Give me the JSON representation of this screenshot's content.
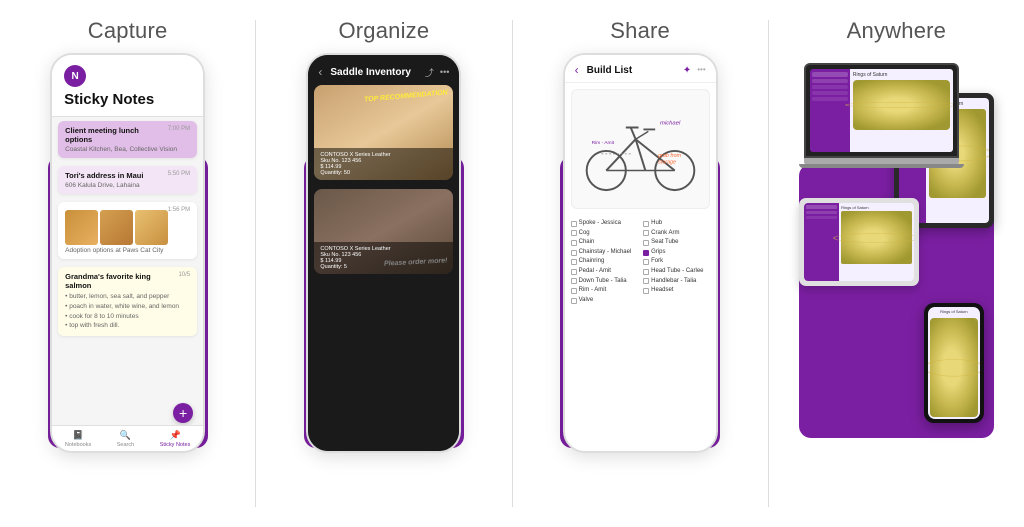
{
  "sections": [
    {
      "id": "capture",
      "title": "Capture",
      "app": {
        "header_icon": "N",
        "title": "Sticky Notes",
        "notes": [
          {
            "title": "Client meeting lunch options",
            "subtitle": "Coastal Kitchen, Bea, Collective Vision",
            "time": "7:00 PM",
            "type": "highlight"
          },
          {
            "title": "Tori's address in Maui",
            "subtitle": "606 Kalula Drive, Lahaina",
            "time": "5:50 PM",
            "type": "highlight2"
          },
          {
            "title": "Adoption options at Paws Cat City",
            "subtitle": "",
            "time": "1:56 PM",
            "type": "image"
          },
          {
            "title": "Grandma's favorite king salmon",
            "subtitle": "• butter, lemon, sea salt, and pepper\n• poach in water, white wine, and lemon\n• cook for 8 to 10 minutes\n• top with fresh dill.",
            "time": "10/5",
            "type": "yellow"
          }
        ],
        "nav_items": [
          {
            "label": "Notebooks",
            "icon": "📓",
            "active": false
          },
          {
            "label": "Search",
            "icon": "🔍",
            "active": false
          },
          {
            "label": "Sticky Notes",
            "icon": "📌",
            "active": true
          }
        ]
      }
    },
    {
      "id": "organize",
      "title": "Organize",
      "app": {
        "title": "Saddle Inventory",
        "items": [
          {
            "product": "CONTOSO X Series Leather",
            "sku": "Sku No. 123 456",
            "price": "$ 114.99",
            "quantity": "Quantity: 50",
            "annotation": "TOP RECOMMENDATION",
            "annotation_color": "#ffeb3b"
          },
          {
            "product": "CONTOSO X Series Leather",
            "sku": "Sku No. 123 456",
            "price": "$ 114.99",
            "quantity": "Quantity: 5",
            "annotation": "Please order more!",
            "annotation_color": "#ffffff"
          }
        ]
      }
    },
    {
      "id": "share",
      "title": "Share",
      "app": {
        "title": "Build List",
        "col1_items": [
          "Spoke - Jessica",
          "Cog",
          "Chain",
          "Chainstay - Michael",
          "Chainring",
          "Pedal - Amit",
          "Down Tube - Talia",
          "Rim - Amit",
          "Valve"
        ],
        "col2_items": [
          "Hub",
          "Crank Arm",
          "Seat Tube",
          "Grips",
          "Fork",
          "Head Tube - Carlee",
          "Handlebar - Talia",
          "Headset"
        ],
        "grab_annotation": "grab from storage"
      }
    },
    {
      "id": "anywhere",
      "title": "Anywhere",
      "screen_content": "Rings of Saturn"
    }
  ],
  "brand_color": "#7B1FA2",
  "bg_color": "#ffffff"
}
